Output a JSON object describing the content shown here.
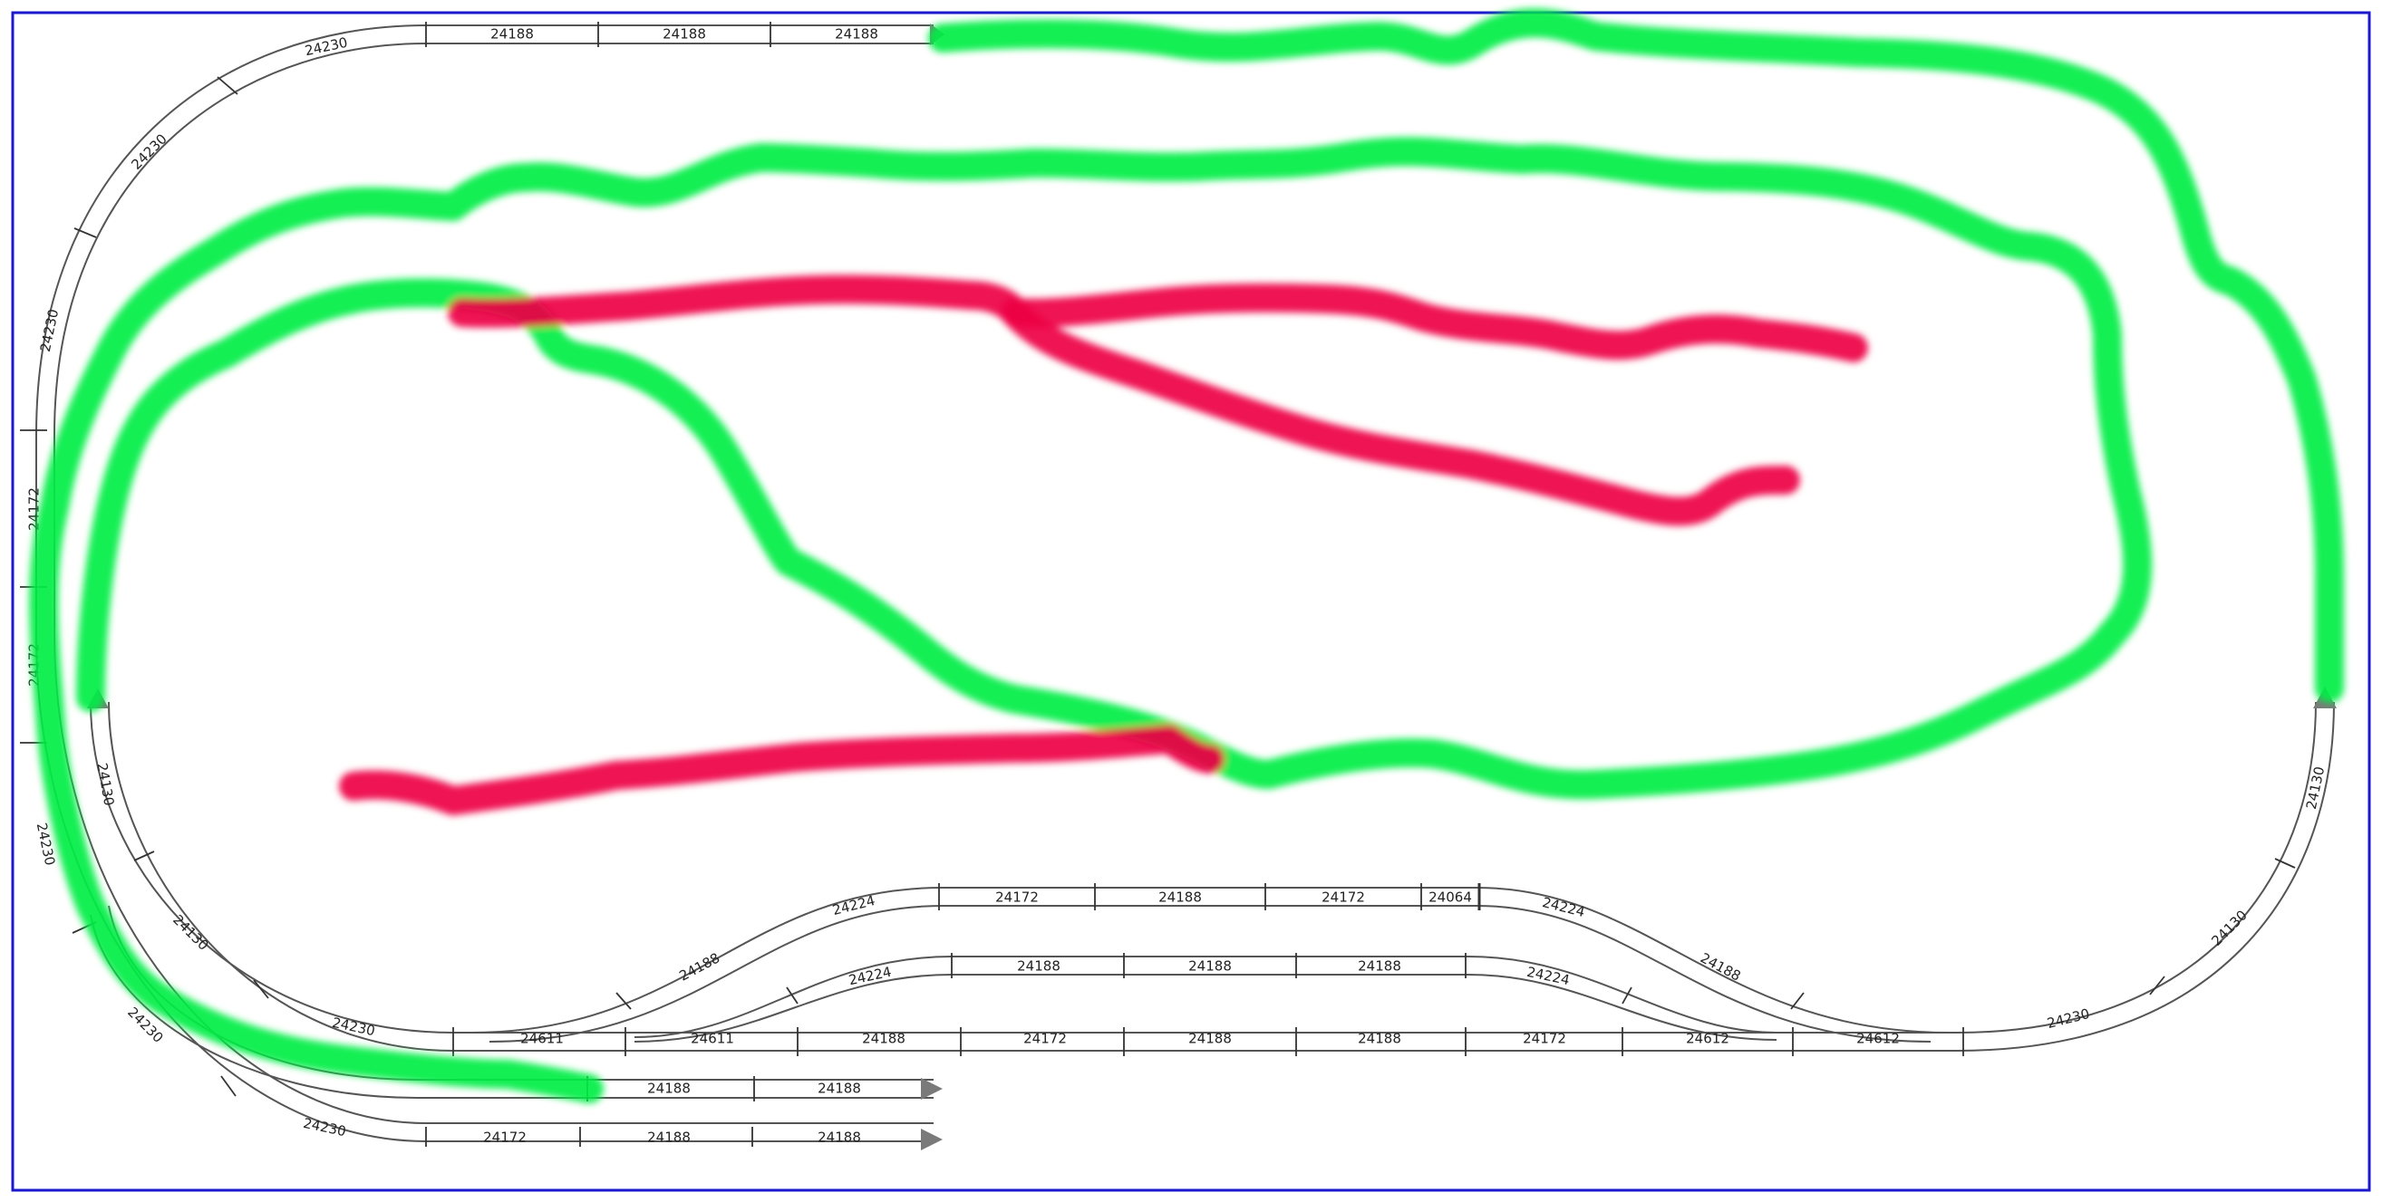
{
  "colors": {
    "frame": "#1a1acc",
    "track": "#555555",
    "arrow": "#7a7a7a",
    "route_green": "#00ee44",
    "route_red": "#ee0044"
  },
  "track_labels": {
    "top_straight": [
      "24188",
      "24188",
      "24188"
    ],
    "top_left_curves": [
      "24230",
      "24230",
      "24230"
    ],
    "left_straights": [
      "24172",
      "24172"
    ],
    "left_curves_outer": [
      "24230",
      "24230",
      "24230"
    ],
    "left_curves_inner": [
      "24130",
      "24130",
      "24230"
    ],
    "upper_siding": [
      "24172",
      "24188",
      "24172",
      "24064"
    ],
    "upper_siding_curves": [
      "24224",
      "24188",
      "24224",
      "24188"
    ],
    "middle_siding": [
      "24188",
      "24188",
      "24188"
    ],
    "middle_siding_curves": [
      "24224",
      "24224"
    ],
    "main_straight": [
      "24611",
      "24611",
      "24188",
      "24172",
      "24188",
      "24188",
      "24172",
      "24612",
      "24612"
    ],
    "right_curves": [
      "24130",
      "24130",
      "24230"
    ],
    "bottom_stub_1": [
      "24188",
      "24188"
    ],
    "bottom_stub_2": [
      "24172",
      "24188",
      "24188"
    ]
  }
}
